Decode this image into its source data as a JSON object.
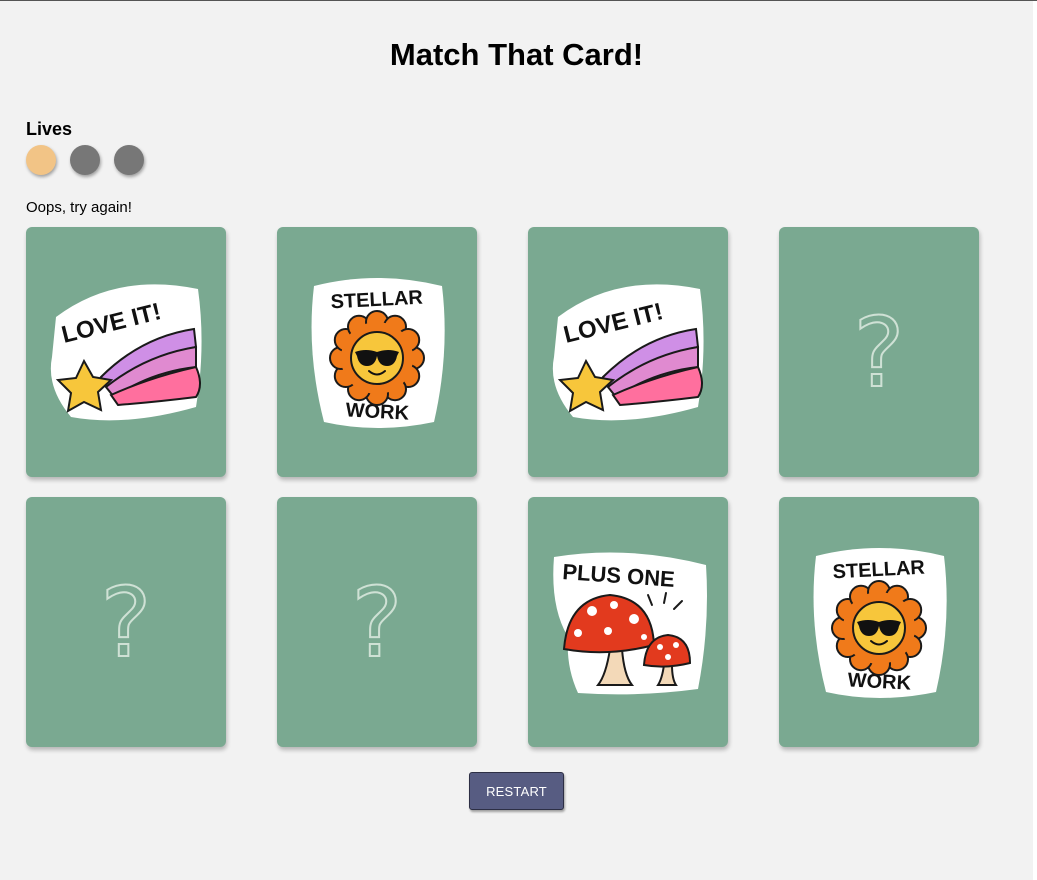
{
  "page_title": "Match That Card!",
  "lives": {
    "label": "Lives",
    "total": 3,
    "remaining": 1,
    "active_color": "#f2c486",
    "lost_color": "#777777"
  },
  "status_message": "Oops, try again!",
  "card_back_color": "#7aa991",
  "cards": [
    {
      "state": "face-up",
      "sticker": "love-it",
      "sticker_text": "LOVE IT!"
    },
    {
      "state": "face-up",
      "sticker": "stellar-work",
      "sticker_text": [
        "STELLAR",
        "WORK"
      ]
    },
    {
      "state": "face-up",
      "sticker": "love-it",
      "sticker_text": "LOVE IT!"
    },
    {
      "state": "face-down",
      "back_glyph": "?"
    },
    {
      "state": "face-down",
      "back_glyph": "?"
    },
    {
      "state": "face-down",
      "back_glyph": "?"
    },
    {
      "state": "face-up",
      "sticker": "plus-one",
      "sticker_text": "PLUS ONE"
    },
    {
      "state": "face-up",
      "sticker": "stellar-work",
      "sticker_text": [
        "STELLAR",
        "WORK"
      ]
    }
  ],
  "restart_label": "RESTART"
}
